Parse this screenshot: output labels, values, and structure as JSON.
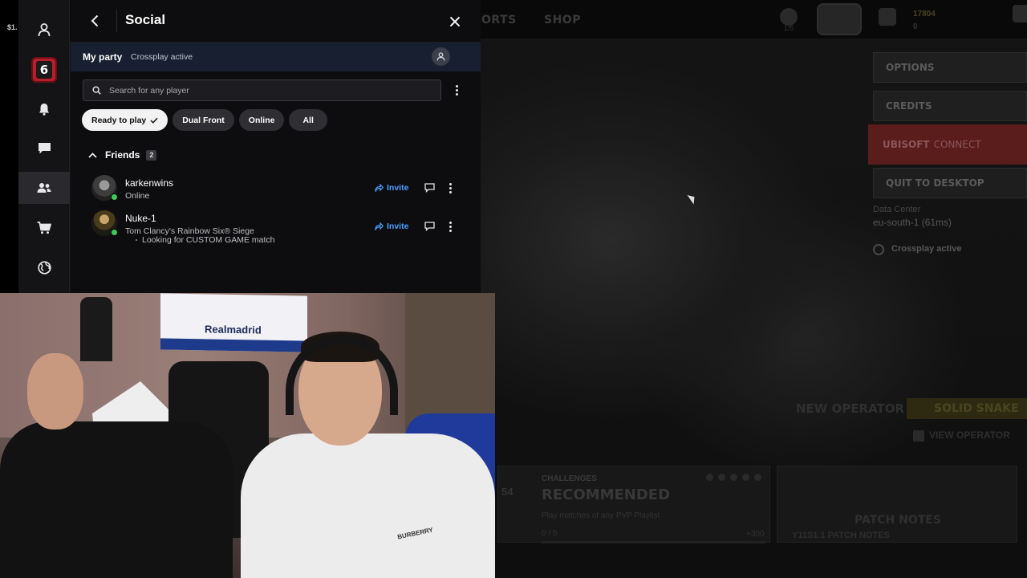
{
  "game": {
    "nav_sports": "ORTS",
    "nav_shop": "SHOP",
    "topbar_count": "1/5",
    "currency_renown": "17804",
    "currency_credits": "0",
    "menu": {
      "options": "OPTIONS",
      "credits": "CREDITS",
      "ubisoft_a": "UBISOFT",
      "ubisoft_b": "CONNECT",
      "quit": "QUIT TO DESKTOP"
    },
    "data_center_label": "Data Center",
    "data_center_value": "eu-south-1 (61ms)",
    "crossplay": "Crossplay active",
    "new_operator": "NEW OPERATOR",
    "operator_name": "SOLID SNAKE",
    "view_operator": "VIEW OPERATOR",
    "challenges_label": "CHALLENGES",
    "challenges_title": "RECOMMENDED",
    "challenges_desc": "Play matches of any PVP Playlist",
    "challenges_progress": "0 / 5",
    "challenges_reward": "+300",
    "challenges_num": "54",
    "patch_title": "PATCH NOTES",
    "patch_sub": "Y11S1.1 PATCH NOTES"
  },
  "edge_label": "$1.",
  "rail": {
    "items": [
      {
        "name": "profile-icon"
      },
      {
        "name": "rainbow-six-logo",
        "glyph": "6"
      },
      {
        "name": "notifications-icon"
      },
      {
        "name": "chat-icon"
      },
      {
        "name": "friends-icon"
      },
      {
        "name": "store-icon"
      },
      {
        "name": "globe-icon"
      }
    ],
    "accent": "#b81d2b"
  },
  "social": {
    "title": "Social",
    "party_label": "My party",
    "party_status": "Crossplay active",
    "search_placeholder": "Search for any player",
    "filters": {
      "ready": "Ready to play",
      "dual_front": "Dual Front",
      "online": "Online",
      "all": "All"
    },
    "friends_label": "Friends",
    "friends_count": "2",
    "friends": [
      {
        "name": "karkenwins",
        "status": "Online",
        "activity": "",
        "invite": "Invite",
        "presence_color": "#3fc85a"
      },
      {
        "name": "Nuke-1",
        "status": "Tom Clancy's Rainbow Six® Siege",
        "activity": "Looking for CUSTOM GAME match",
        "invite": "Invite",
        "presence_color": "#3fc85a"
      }
    ],
    "link_color": "#4aa0ff"
  },
  "webcam": {
    "flag_text": "Realmadrid",
    "hoodie_text": "BURBERRY"
  }
}
